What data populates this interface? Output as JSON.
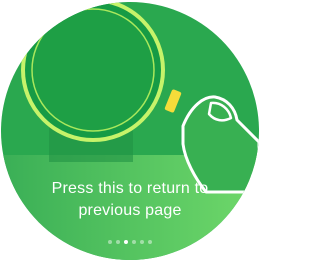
{
  "onboarding": {
    "instruction_line1": "Press this to return to",
    "instruction_line2": "previous page",
    "pager": {
      "total_pages": 6,
      "current_page": 3
    }
  },
  "colors": {
    "background_green": "#2aa84f",
    "band_green": "#4bc46b",
    "watch_dark_green": "#169b45",
    "ring_lime": "#c6f36a",
    "button_yellow": "#f5dc3a",
    "finger_outline": "#ffffff",
    "text": "#ffffff"
  },
  "icons": {
    "illustration": "watch-and-finger-illustration"
  }
}
